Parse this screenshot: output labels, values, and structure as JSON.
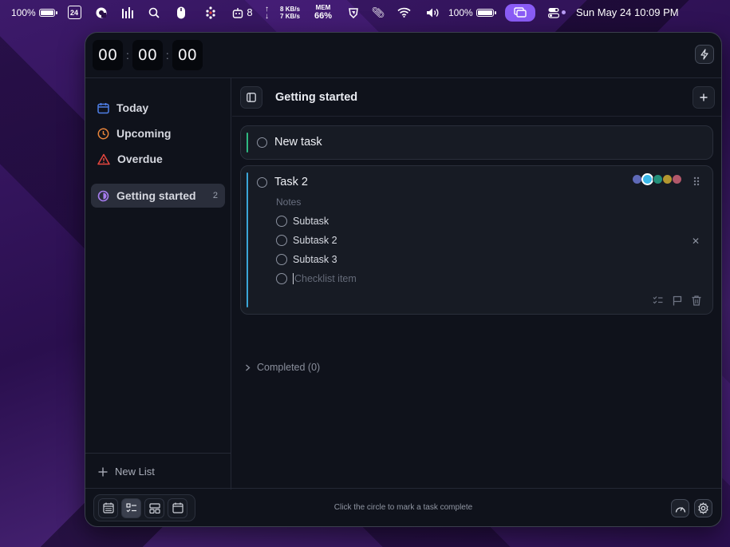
{
  "menubar": {
    "battery_left": "100%",
    "calendar_day": "24",
    "cpu_count": "8",
    "net_up": "8 KB/s",
    "net_down": "7 KB/s",
    "mem_label": "MEM",
    "mem_value": "66%",
    "battery_right": "100%",
    "clock": "Sun May 24  10:09 PM"
  },
  "timer": {
    "hours": "00",
    "minutes": "00",
    "seconds": "00",
    "sep": ":"
  },
  "sidebar": {
    "items": [
      {
        "label": "Today",
        "icon": "calendar-icon",
        "color": "#4f7fe8"
      },
      {
        "label": "Upcoming",
        "icon": "clock-icon",
        "color": "#e8843a"
      },
      {
        "label": "Overdue",
        "icon": "warning-icon",
        "color": "#e8473f"
      }
    ],
    "lists": [
      {
        "label": "Getting started",
        "count": "2",
        "icon": "half-circle-icon",
        "color": "#a77cf0"
      }
    ],
    "new_list": "New List"
  },
  "main": {
    "title": "Getting started",
    "tasks": [
      {
        "title": "New task",
        "bar_color": "#2fb981"
      },
      {
        "title": "Task 2",
        "bar_color": "#3aa6d8",
        "notes_placeholder": "Notes",
        "subtasks": [
          "Subtask",
          "Subtask 2",
          "Subtask 3"
        ],
        "checklist_placeholder": "Checklist item",
        "swatches": [
          "#5e69b7",
          "#3bb8e8",
          "#23907a",
          "#b3962f",
          "#b2586a"
        ],
        "selected_swatch": "#3bb8e8"
      }
    ],
    "completed_label": "Completed (0)"
  },
  "footer": {
    "hint": "Click the circle to mark a task complete"
  }
}
